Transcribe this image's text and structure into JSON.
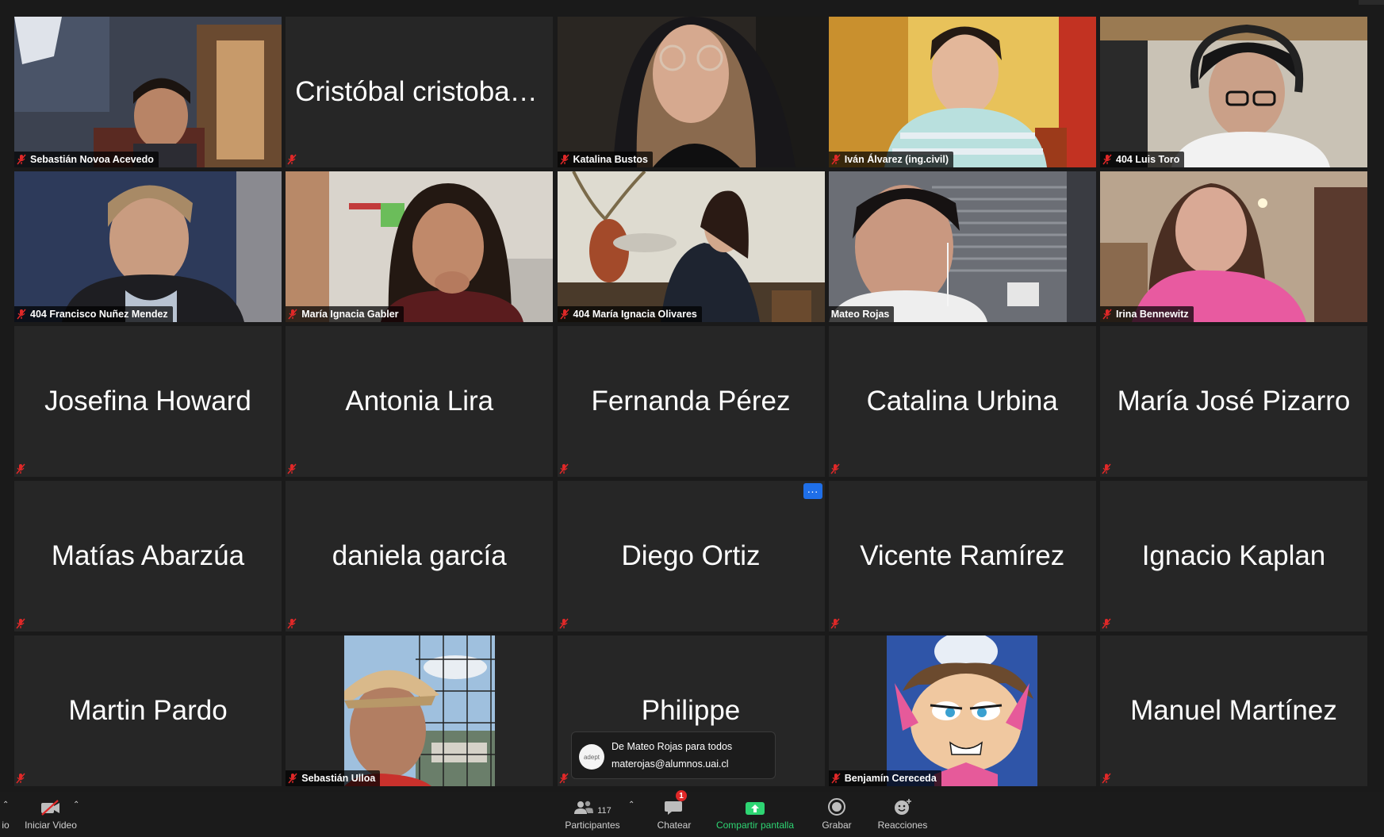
{
  "colors": {
    "background": "#1a1a1a",
    "tile": "#262626",
    "speaking_outline": "#d8e27c",
    "muted_icon": "#e02828",
    "share_green": "#2ed573",
    "more_button": "#1f6fe8"
  },
  "participants": [
    {
      "name": "Sebastián Novoa Acevedo",
      "video": true
    },
    {
      "name": "Cristóbal cristobal.u...",
      "video": false
    },
    {
      "name": "Katalina Bustos",
      "video": true
    },
    {
      "name": "Iván Álvarez (ing.civil)",
      "video": true
    },
    {
      "name": "404 Luis Toro",
      "video": true
    },
    {
      "name": "404 Francisco Nuñez Mendez",
      "video": true
    },
    {
      "name": "María Ignacia Gabler",
      "video": true
    },
    {
      "name": "404 María Ignacia Olivares",
      "video": true
    },
    {
      "name": "Mateo Rojas",
      "video": true,
      "speaking": true
    },
    {
      "name": "Irina Bennewitz",
      "video": true
    },
    {
      "name": "Josefina Howard",
      "video": false
    },
    {
      "name": "Antonia Lira",
      "video": false
    },
    {
      "name": "Fernanda Pérez",
      "video": false
    },
    {
      "name": "Catalina Urbina",
      "video": false
    },
    {
      "name": "María José Pizarro",
      "video": false
    },
    {
      "name": "Matías Abarzúa",
      "video": false
    },
    {
      "name": "daniela garcía",
      "video": false
    },
    {
      "name": "Diego Ortiz",
      "video": false,
      "more_button": "···"
    },
    {
      "name": "Vicente Ramírez",
      "video": false
    },
    {
      "name": "Ignacio Kaplan",
      "video": false
    },
    {
      "name": "Martin Pardo",
      "video": false
    },
    {
      "name": "Sebastián Ulloa",
      "video": true
    },
    {
      "name": "Philippe",
      "video": false
    },
    {
      "name": "Benjamín Cereceda",
      "video": true
    },
    {
      "name": "Manuel Martínez",
      "video": false
    }
  ],
  "toolbar": {
    "audio_label_partial": "io",
    "video_label": "Iniciar Video",
    "participants_label": "Participantes",
    "participants_count": "117",
    "chat_label": "Chatear",
    "chat_badge": "1",
    "share_label": "Compartir pantalla",
    "record_label": "Grabar",
    "reactions_label": "Reacciones"
  },
  "chat_popup": {
    "avatar_text": "adept",
    "from": "De Mateo Rojas para todos",
    "message": "materojas@alumnos.uai.cl"
  }
}
